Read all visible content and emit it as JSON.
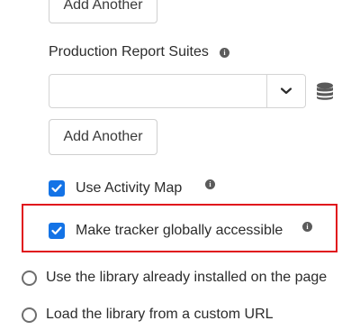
{
  "add_another_top": {
    "label": "Add Another"
  },
  "production_report_suites": {
    "label": "Production Report Suites",
    "info_icon": "info-icon",
    "input_value": "",
    "dropdown_icon": "chevron-down-icon",
    "data_element_icon": "database-icon",
    "add_another_label": "Add Another"
  },
  "options": {
    "activity_map": {
      "label": "Use Activity Map",
      "checked": true
    },
    "global_tracker": {
      "label": "Make tracker globally accessible",
      "checked": true
    }
  },
  "library_choice": {
    "installed": {
      "label": "Use the library already installed on the page",
      "selected": false
    },
    "custom_url": {
      "label": "Load the library from a custom URL",
      "selected": false
    }
  },
  "colors": {
    "checkbox_accent": "#1473e6",
    "highlight_border": "#e0131c"
  }
}
